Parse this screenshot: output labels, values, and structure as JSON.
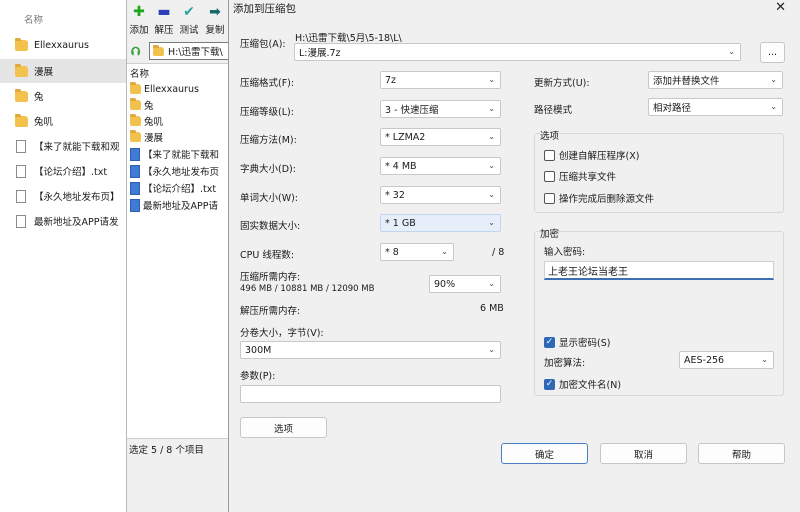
{
  "explorer": {
    "header": "名称",
    "items": [
      {
        "label": "Ellexxaurus",
        "type": "folder"
      },
      {
        "label": "漫展",
        "type": "folder",
        "selected": true
      },
      {
        "label": "兔",
        "type": "folder"
      },
      {
        "label": "兔叽",
        "type": "folder"
      },
      {
        "label": "【来了就能下载和观",
        "type": "file"
      },
      {
        "label": "【论坛介绍】.txt",
        "type": "file"
      },
      {
        "label": "【永久地址发布页】",
        "type": "file"
      },
      {
        "label": "最新地址及APP请发",
        "type": "file"
      }
    ]
  },
  "fm": {
    "toolbar": {
      "add": "添加",
      "extract": "解压",
      "test": "测试",
      "copy": "复制"
    },
    "address": "H:\\迅雷下载\\",
    "list_header": "名称",
    "items": [
      {
        "label": "Ellexxaurus",
        "type": "folder"
      },
      {
        "label": "兔",
        "type": "folder"
      },
      {
        "label": "兔叽",
        "type": "folder"
      },
      {
        "label": "漫展",
        "type": "folder"
      },
      {
        "label": "【来了就能下载和",
        "type": "file"
      },
      {
        "label": "【永久地址发布页",
        "type": "file"
      },
      {
        "label": "【论坛介绍】.txt",
        "type": "file"
      },
      {
        "label": "最新地址及APP请",
        "type": "file"
      }
    ],
    "status": "选定 5 / 8 个项目"
  },
  "dialog": {
    "title": "添加到压缩包",
    "archive_label": "压缩包(A):",
    "archive_path": "H:\\迅雷下载\\5月\\5-18\\L\\",
    "archive_name": "L:漫展.7z",
    "browse_label": "...",
    "format": {
      "label": "压缩格式(F):",
      "value": "7z"
    },
    "level": {
      "label": "压缩等级(L):",
      "value": "3 - 快速压缩"
    },
    "method": {
      "label": "压缩方法(M):",
      "value": "* LZMA2"
    },
    "dict": {
      "label": "字典大小(D):",
      "value": "* 4 MB"
    },
    "word": {
      "label": "单词大小(W):",
      "value": "* 32"
    },
    "solid": {
      "label": "固实数据大小:",
      "value": "* 1 GB"
    },
    "threads": {
      "label": "CPU 线程数:",
      "value": "* 8",
      "max": "/ 8"
    },
    "mem_comp": {
      "label": "压缩所需内存:",
      "detail": "496 MB / 10881 MB / 12090 MB",
      "value": "90%"
    },
    "mem_decomp": {
      "label": "解压所需内存:",
      "value": "6 MB"
    },
    "volume": {
      "label": "分卷大小，字节(V):",
      "value": "300M"
    },
    "params": {
      "label": "参数(P):",
      "value": ""
    },
    "options_btn": "选项",
    "update": {
      "label": "更新方式(U):",
      "value": "添加并替换文件"
    },
    "path_mode": {
      "label": "路径模式",
      "value": "相对路径"
    },
    "options_group": {
      "title": "选项",
      "items": [
        {
          "label": "创建自解压程序(X)",
          "checked": false
        },
        {
          "label": "压缩共享文件",
          "checked": false
        },
        {
          "label": "操作完成后删除源文件",
          "checked": false
        }
      ]
    },
    "encryption": {
      "title": "加密",
      "password_label": "输入密码:",
      "password": "上老王论坛当老王",
      "show_password": {
        "label": "显示密码(S)",
        "checked": true
      },
      "method_label": "加密算法:",
      "method_value": "AES-256",
      "encrypt_names": {
        "label": "加密文件名(N)",
        "checked": true
      }
    },
    "ok": "确定",
    "cancel": "取消",
    "help": "帮助"
  }
}
